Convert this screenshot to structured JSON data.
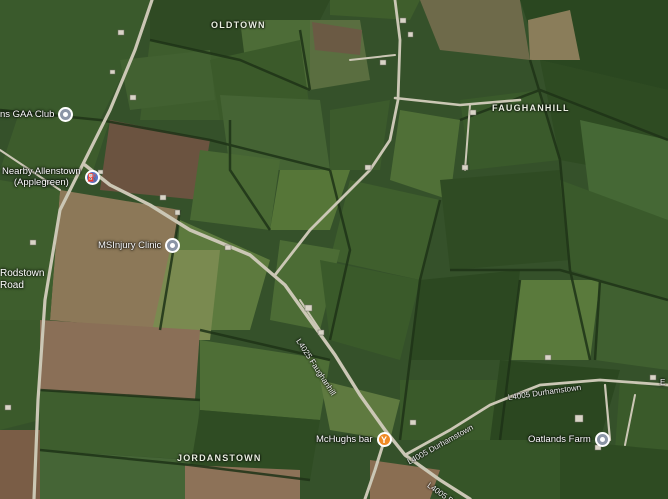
{
  "places": {
    "oldtown": "OLDTOWN",
    "faughanhill": "FAUGHANHILL",
    "jordanstown": "JORDANSTOWN",
    "rodstown_line1": "Rodstown",
    "rodstown_line2": "Road"
  },
  "pois": {
    "gaa": "ns GAA Club",
    "fuel_line1": "Nearby Allenstown",
    "fuel_line2": "(Applegreen)",
    "clinic": "MSInjury Clinic",
    "bar": "McHughs bar",
    "farm": "Oatlands Farm"
  },
  "roads": {
    "l4025": "L4025 Faughanhill",
    "l4005a": "L4005 Durhamstown",
    "l4005b": "L4005 Durhamstown",
    "l4005c": "L4005 Du",
    "edge_e": "E"
  },
  "colors": {
    "road": "#c9c6b4",
    "field_dark": "#2d4a20",
    "field_light": "#4c6d32",
    "field_brown": "#6b5340"
  }
}
